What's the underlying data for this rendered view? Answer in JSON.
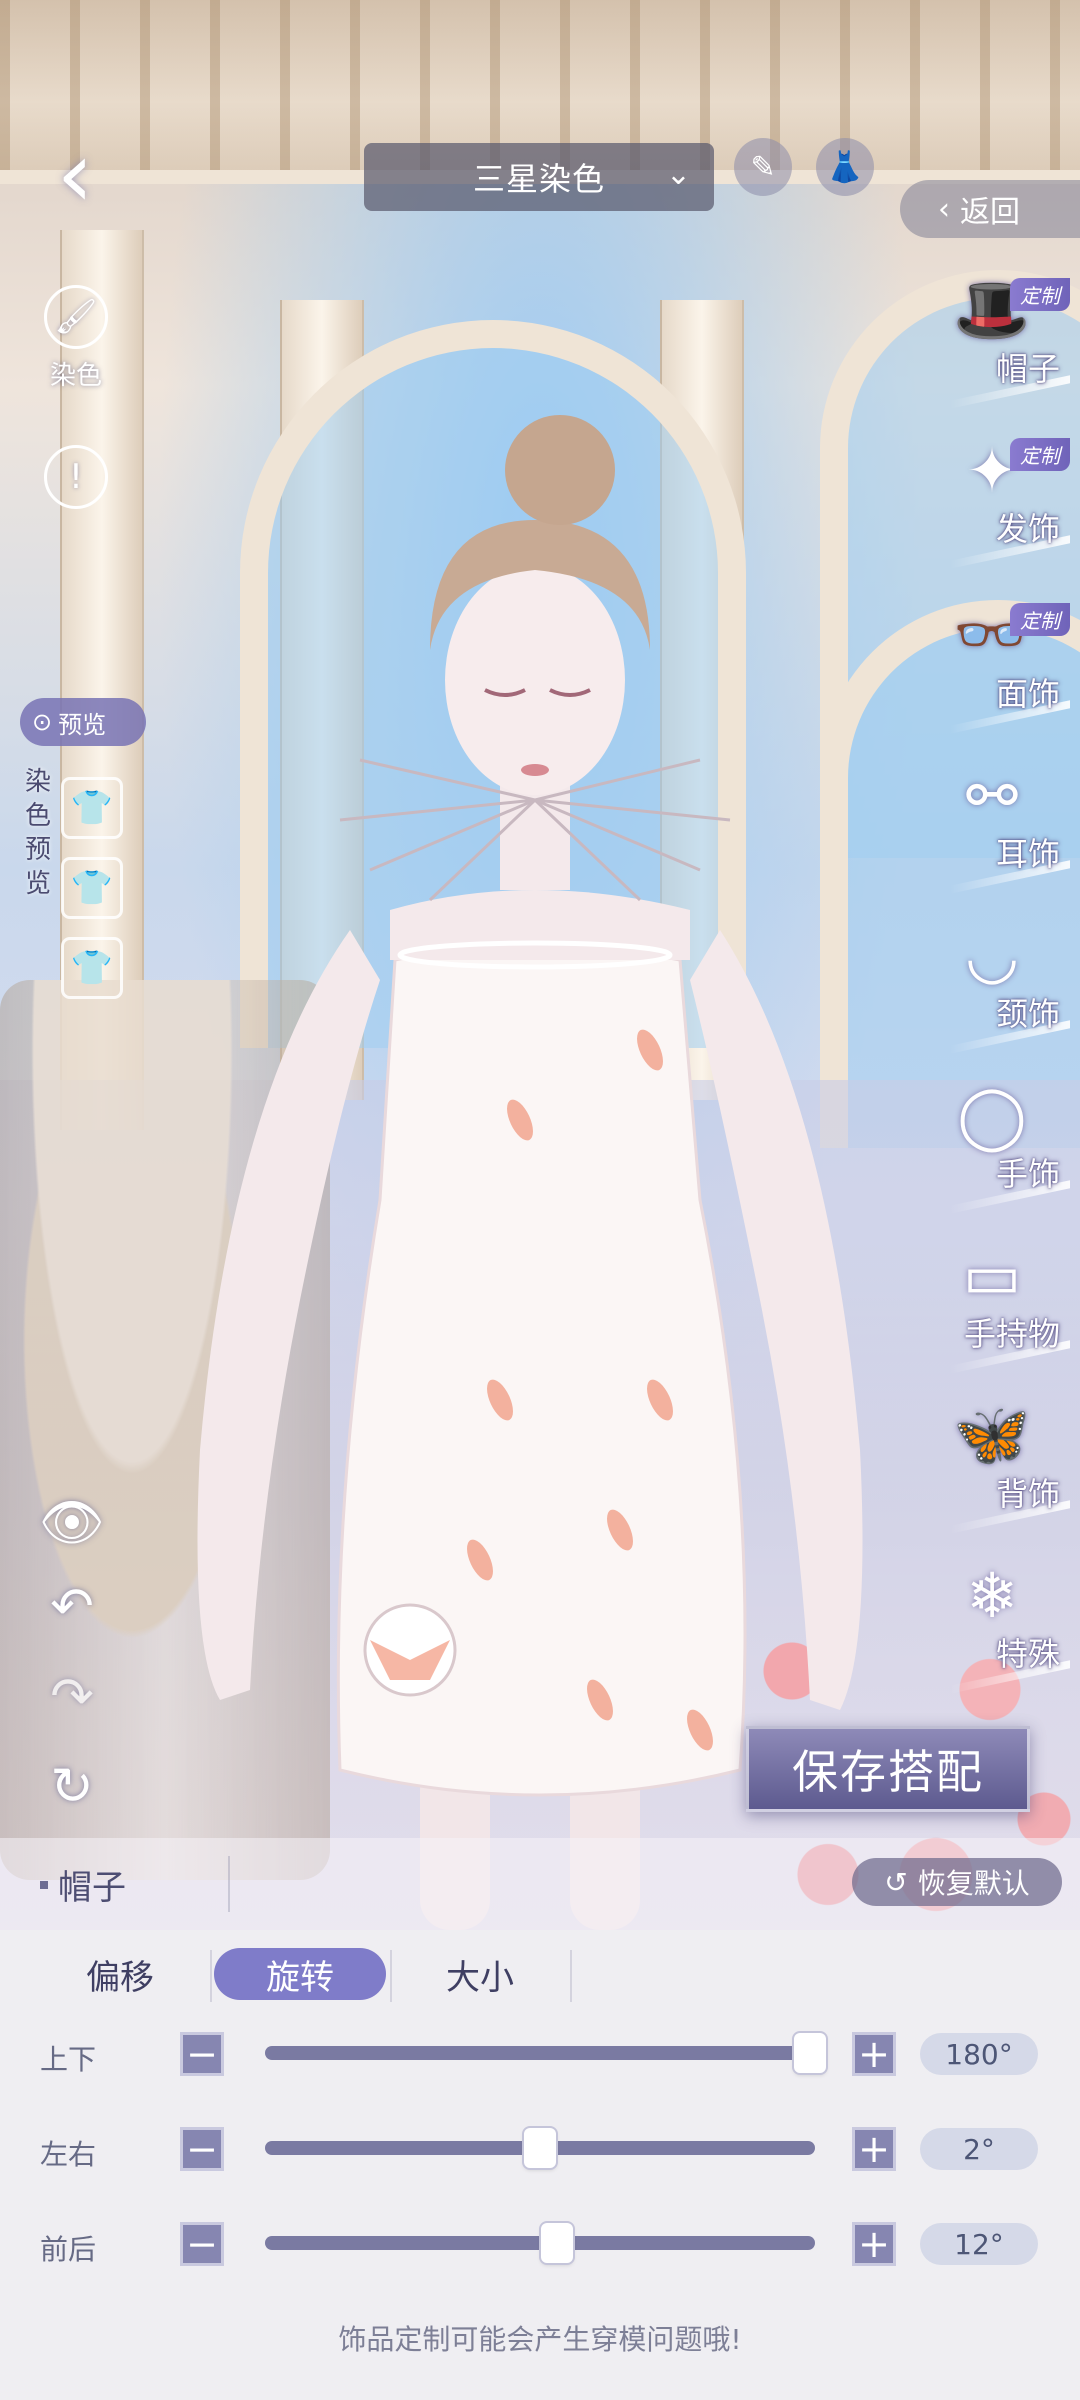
{
  "header": {
    "back_icon": "chevron-left-icon",
    "dye_mode_select": "三星染色",
    "return_label": "返回"
  },
  "left_tools": {
    "dye_label": "染色",
    "preview_label": "预览",
    "dye_preview_label": "染色预览",
    "swatches": [
      {
        "color": "#f3a6b3",
        "icon": "shirt-icon"
      },
      {
        "color": "#ffffff",
        "icon": "shirt-icon"
      },
      {
        "color": "#ffffff",
        "icon": "shirt-icon"
      }
    ]
  },
  "categories": [
    {
      "label": "帽子",
      "icon": "hat-icon",
      "badge": "定制"
    },
    {
      "label": "发饰",
      "icon": "hairpin-icon",
      "badge": "定制"
    },
    {
      "label": "面饰",
      "icon": "glasses-icon",
      "badge": "定制"
    },
    {
      "label": "耳饰",
      "icon": "earring-icon",
      "badge": ""
    },
    {
      "label": "颈饰",
      "icon": "necklace-icon",
      "badge": ""
    },
    {
      "label": "手饰",
      "icon": "bracelet-icon",
      "badge": ""
    },
    {
      "label": "手持物",
      "icon": "handheld-icon",
      "badge": ""
    },
    {
      "label": "背饰",
      "icon": "wings-icon",
      "badge": ""
    },
    {
      "label": "特殊",
      "icon": "snowflake-icon",
      "badge": ""
    }
  ],
  "save_button": "保存搭配",
  "slot_bar": {
    "title": "帽子",
    "reset_label": "恢复默认"
  },
  "panel": {
    "tabs": [
      {
        "label": "偏移",
        "active": false
      },
      {
        "label": "旋转",
        "active": true
      },
      {
        "label": "大小",
        "active": false
      }
    ],
    "sliders": [
      {
        "label": "上下",
        "value": "180°",
        "fraction": 0.99
      },
      {
        "label": "左右",
        "value": "2°",
        "fraction": 0.5
      },
      {
        "label": "前后",
        "value": "12°",
        "fraction": 0.53
      }
    ],
    "notice": "饰品定制可能会产生穿模问题哦!"
  },
  "colors": {
    "accent": "#7f7cc9",
    "track": "#7a7aa2",
    "stepper": "#8686b1"
  }
}
